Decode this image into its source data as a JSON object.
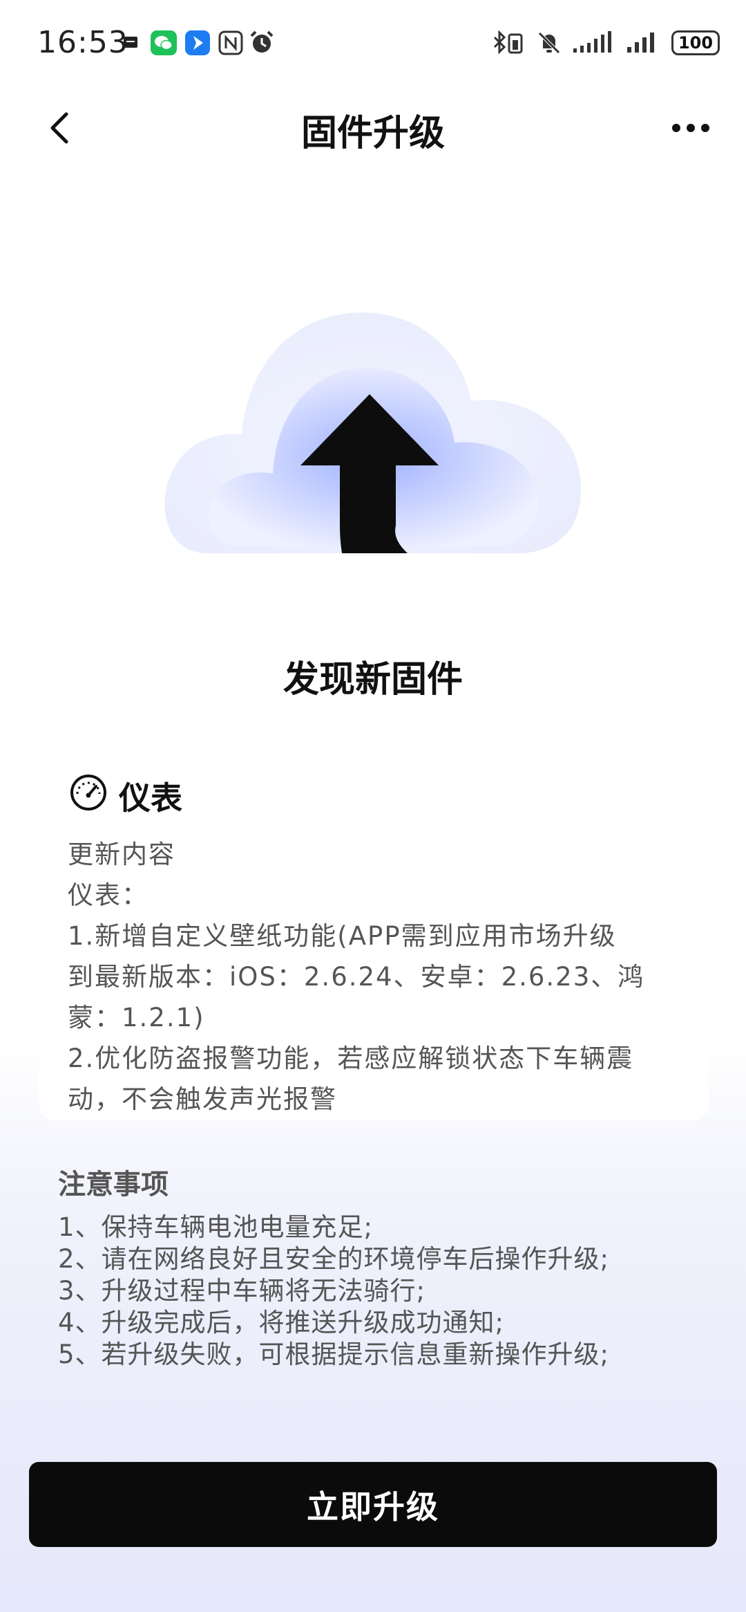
{
  "status_bar": {
    "time": "16:53",
    "battery": "100",
    "icons": [
      "sim-card-icon",
      "wechat-icon",
      "blue-app-icon",
      "nfc-icon",
      "alarm-icon",
      "bluetooth-battery-icon",
      "mute-bell-icon",
      "signal-icon",
      "signal-icon"
    ]
  },
  "header": {
    "title": "固件升级"
  },
  "main": {
    "found_title": "发现新固件",
    "device_name": "仪表",
    "notes": [
      "更新内容",
      "仪表：",
      "1.新增自定义壁纸功能(APP需到应用市场升级",
      "到最新版本：iOS：2.6.24、安卓：2.6.23、鸿",
      "蒙：1.2.1)",
      "2.优化防盗报警功能，若感应解锁状态下车辆震",
      "动，不会触发声光报警"
    ],
    "attention_title": "注意事项",
    "attention_items": [
      "1、保持车辆电池电量充足;",
      "2、请在网络良好且安全的环境停车后操作升级;",
      "3、升级过程中车辆将无法骑行;",
      "4、升级完成后，将推送升级成功通知;",
      "5、若升级失败，可根据提示信息重新操作升级;"
    ],
    "upgrade_button": "立即升级"
  },
  "colors": {
    "button_bg": "#0b0b0b",
    "cloud_accent": "#9db0ff",
    "text_secondary": "#555555"
  }
}
